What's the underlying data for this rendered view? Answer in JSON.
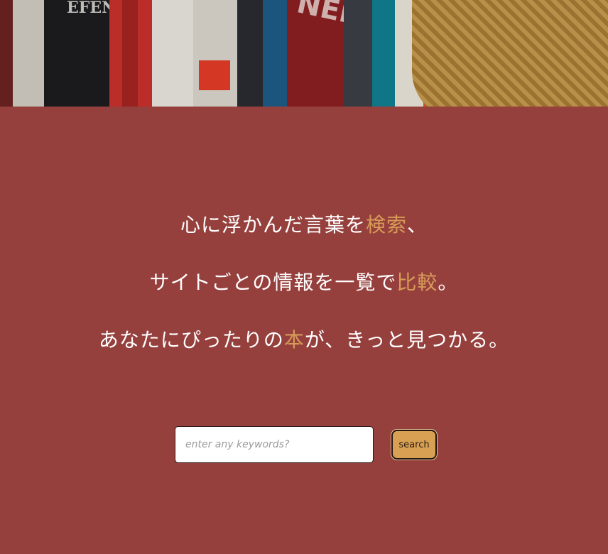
{
  "hero": {
    "image_description_icon": "bookshelf-photo",
    "spine_text_left": "EFENSE",
    "spine_text_right": "NEM"
  },
  "tagline": {
    "lines": [
      {
        "before": "心に浮かんだ言葉を",
        "accent": "検索",
        "after": "、"
      },
      {
        "before": "サイトごとの情報を一覧で",
        "accent": "比較",
        "after": "。"
      },
      {
        "before": "あなたにぴったりの",
        "accent": "本",
        "after": "が、きっと見つかる。"
      }
    ]
  },
  "search": {
    "placeholder": "enter any keywords?",
    "value": "",
    "button_label": "search"
  },
  "colors": {
    "background": "#96403d",
    "accent": "#d79b58",
    "text": "#ffffff",
    "button": "#d7a052"
  }
}
